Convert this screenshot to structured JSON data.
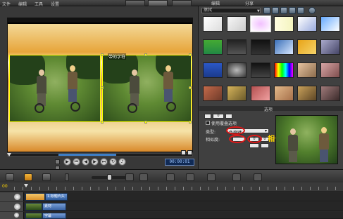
{
  "menu": {
    "items": [
      "文件",
      "编辑",
      "工具",
      "设置"
    ],
    "tabs": [
      "捕获",
      "编辑",
      "分享"
    ]
  },
  "preview": {
    "title_tag": "带的字符",
    "timecode": "00:00:01"
  },
  "transport": {
    "buttons": [
      {
        "name": "play-button",
        "glyph": "▶"
      },
      {
        "name": "home-button",
        "glyph": "⏮"
      },
      {
        "name": "previous-frame-button",
        "glyph": "◀"
      },
      {
        "name": "next-frame-button",
        "glyph": "▶"
      },
      {
        "name": "end-button",
        "glyph": "⏭"
      },
      {
        "name": "repeat-button",
        "glyph": "↻"
      },
      {
        "name": "volume-button",
        "glyph": "♪"
      }
    ]
  },
  "library": {
    "category_dropdown": "擦拭",
    "selected_thumbnail": 2
  },
  "options": {
    "header": "选项",
    "checkbox_label": "使用覆叠选项",
    "type_label": "类型:",
    "type_value": "色度键",
    "similarity_label": "相似度:",
    "spinner_values": [
      "0",
      "0",
      "0"
    ],
    "similarity_note": "相似度"
  },
  "timeline": {
    "ruler_label": "00",
    "clips": [
      {
        "label": "1.标题片头"
      },
      {
        "label": "素材"
      },
      {
        "label": "字幕"
      }
    ]
  },
  "colors": {
    "accent": "#3e7ec5",
    "selection": "#ffff00",
    "annotation_red": "#e01818",
    "annotation_text": "#ffd500"
  }
}
